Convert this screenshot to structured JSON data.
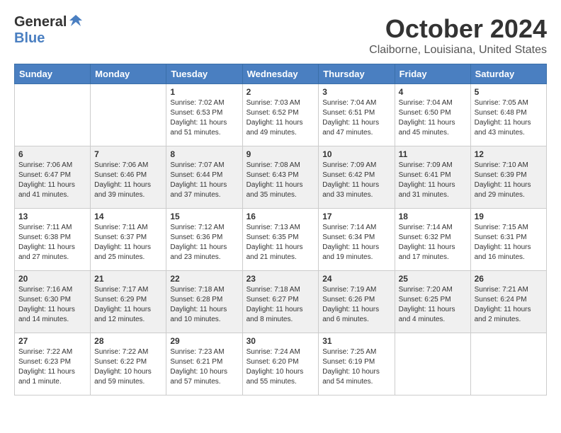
{
  "header": {
    "logo_general": "General",
    "logo_blue": "Blue",
    "month_title": "October 2024",
    "location": "Claiborne, Louisiana, United States"
  },
  "weekdays": [
    "Sunday",
    "Monday",
    "Tuesday",
    "Wednesday",
    "Thursday",
    "Friday",
    "Saturday"
  ],
  "weeks": [
    [
      {
        "day": "",
        "sunrise": "",
        "sunset": "",
        "daylight": ""
      },
      {
        "day": "",
        "sunrise": "",
        "sunset": "",
        "daylight": ""
      },
      {
        "day": "1",
        "sunrise": "Sunrise: 7:02 AM",
        "sunset": "Sunset: 6:53 PM",
        "daylight": "Daylight: 11 hours and 51 minutes."
      },
      {
        "day": "2",
        "sunrise": "Sunrise: 7:03 AM",
        "sunset": "Sunset: 6:52 PM",
        "daylight": "Daylight: 11 hours and 49 minutes."
      },
      {
        "day": "3",
        "sunrise": "Sunrise: 7:04 AM",
        "sunset": "Sunset: 6:51 PM",
        "daylight": "Daylight: 11 hours and 47 minutes."
      },
      {
        "day": "4",
        "sunrise": "Sunrise: 7:04 AM",
        "sunset": "Sunset: 6:50 PM",
        "daylight": "Daylight: 11 hours and 45 minutes."
      },
      {
        "day": "5",
        "sunrise": "Sunrise: 7:05 AM",
        "sunset": "Sunset: 6:48 PM",
        "daylight": "Daylight: 11 hours and 43 minutes."
      }
    ],
    [
      {
        "day": "6",
        "sunrise": "Sunrise: 7:06 AM",
        "sunset": "Sunset: 6:47 PM",
        "daylight": "Daylight: 11 hours and 41 minutes."
      },
      {
        "day": "7",
        "sunrise": "Sunrise: 7:06 AM",
        "sunset": "Sunset: 6:46 PM",
        "daylight": "Daylight: 11 hours and 39 minutes."
      },
      {
        "day": "8",
        "sunrise": "Sunrise: 7:07 AM",
        "sunset": "Sunset: 6:44 PM",
        "daylight": "Daylight: 11 hours and 37 minutes."
      },
      {
        "day": "9",
        "sunrise": "Sunrise: 7:08 AM",
        "sunset": "Sunset: 6:43 PM",
        "daylight": "Daylight: 11 hours and 35 minutes."
      },
      {
        "day": "10",
        "sunrise": "Sunrise: 7:09 AM",
        "sunset": "Sunset: 6:42 PM",
        "daylight": "Daylight: 11 hours and 33 minutes."
      },
      {
        "day": "11",
        "sunrise": "Sunrise: 7:09 AM",
        "sunset": "Sunset: 6:41 PM",
        "daylight": "Daylight: 11 hours and 31 minutes."
      },
      {
        "day": "12",
        "sunrise": "Sunrise: 7:10 AM",
        "sunset": "Sunset: 6:39 PM",
        "daylight": "Daylight: 11 hours and 29 minutes."
      }
    ],
    [
      {
        "day": "13",
        "sunrise": "Sunrise: 7:11 AM",
        "sunset": "Sunset: 6:38 PM",
        "daylight": "Daylight: 11 hours and 27 minutes."
      },
      {
        "day": "14",
        "sunrise": "Sunrise: 7:11 AM",
        "sunset": "Sunset: 6:37 PM",
        "daylight": "Daylight: 11 hours and 25 minutes."
      },
      {
        "day": "15",
        "sunrise": "Sunrise: 7:12 AM",
        "sunset": "Sunset: 6:36 PM",
        "daylight": "Daylight: 11 hours and 23 minutes."
      },
      {
        "day": "16",
        "sunrise": "Sunrise: 7:13 AM",
        "sunset": "Sunset: 6:35 PM",
        "daylight": "Daylight: 11 hours and 21 minutes."
      },
      {
        "day": "17",
        "sunrise": "Sunrise: 7:14 AM",
        "sunset": "Sunset: 6:34 PM",
        "daylight": "Daylight: 11 hours and 19 minutes."
      },
      {
        "day": "18",
        "sunrise": "Sunrise: 7:14 AM",
        "sunset": "Sunset: 6:32 PM",
        "daylight": "Daylight: 11 hours and 17 minutes."
      },
      {
        "day": "19",
        "sunrise": "Sunrise: 7:15 AM",
        "sunset": "Sunset: 6:31 PM",
        "daylight": "Daylight: 11 hours and 16 minutes."
      }
    ],
    [
      {
        "day": "20",
        "sunrise": "Sunrise: 7:16 AM",
        "sunset": "Sunset: 6:30 PM",
        "daylight": "Daylight: 11 hours and 14 minutes."
      },
      {
        "day": "21",
        "sunrise": "Sunrise: 7:17 AM",
        "sunset": "Sunset: 6:29 PM",
        "daylight": "Daylight: 11 hours and 12 minutes."
      },
      {
        "day": "22",
        "sunrise": "Sunrise: 7:18 AM",
        "sunset": "Sunset: 6:28 PM",
        "daylight": "Daylight: 11 hours and 10 minutes."
      },
      {
        "day": "23",
        "sunrise": "Sunrise: 7:18 AM",
        "sunset": "Sunset: 6:27 PM",
        "daylight": "Daylight: 11 hours and 8 minutes."
      },
      {
        "day": "24",
        "sunrise": "Sunrise: 7:19 AM",
        "sunset": "Sunset: 6:26 PM",
        "daylight": "Daylight: 11 hours and 6 minutes."
      },
      {
        "day": "25",
        "sunrise": "Sunrise: 7:20 AM",
        "sunset": "Sunset: 6:25 PM",
        "daylight": "Daylight: 11 hours and 4 minutes."
      },
      {
        "day": "26",
        "sunrise": "Sunrise: 7:21 AM",
        "sunset": "Sunset: 6:24 PM",
        "daylight": "Daylight: 11 hours and 2 minutes."
      }
    ],
    [
      {
        "day": "27",
        "sunrise": "Sunrise: 7:22 AM",
        "sunset": "Sunset: 6:23 PM",
        "daylight": "Daylight: 11 hours and 1 minute."
      },
      {
        "day": "28",
        "sunrise": "Sunrise: 7:22 AM",
        "sunset": "Sunset: 6:22 PM",
        "daylight": "Daylight: 10 hours and 59 minutes."
      },
      {
        "day": "29",
        "sunrise": "Sunrise: 7:23 AM",
        "sunset": "Sunset: 6:21 PM",
        "daylight": "Daylight: 10 hours and 57 minutes."
      },
      {
        "day": "30",
        "sunrise": "Sunrise: 7:24 AM",
        "sunset": "Sunset: 6:20 PM",
        "daylight": "Daylight: 10 hours and 55 minutes."
      },
      {
        "day": "31",
        "sunrise": "Sunrise: 7:25 AM",
        "sunset": "Sunset: 6:19 PM",
        "daylight": "Daylight: 10 hours and 54 minutes."
      },
      {
        "day": "",
        "sunrise": "",
        "sunset": "",
        "daylight": ""
      },
      {
        "day": "",
        "sunrise": "",
        "sunset": "",
        "daylight": ""
      }
    ]
  ]
}
